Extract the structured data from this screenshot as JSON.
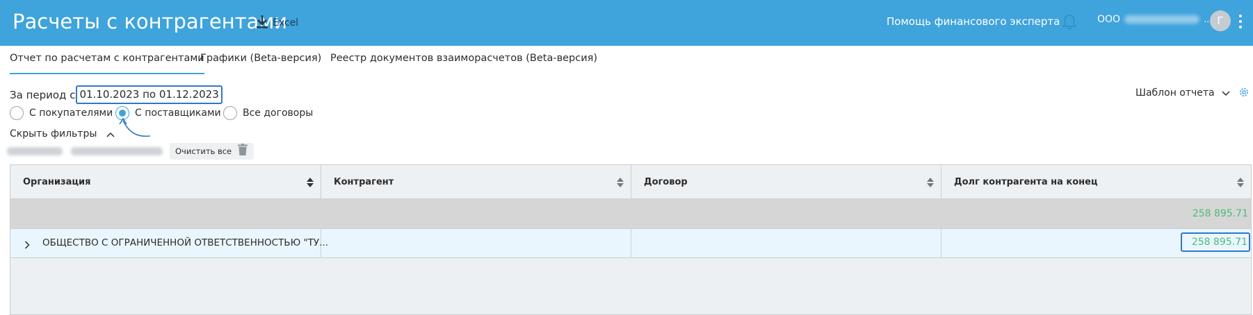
{
  "header": {
    "title": "Расчеты с контрагентами",
    "excel_label": "Excel",
    "help_link": "Помощь финансового эксперта",
    "org_prefix": "ООО",
    "org_suffix": "..",
    "avatar_initial": "Г",
    "icons": [
      "download-icon",
      "bell-icon",
      "kebab-menu-icon"
    ]
  },
  "tabs": [
    {
      "label": "Отчет по расчетам с контрагентами",
      "active": true
    },
    {
      "label": "Графики (Beta-версия)",
      "active": false
    },
    {
      "label": "Реестр документов взаиморасчетов (Beta-версия)",
      "active": false
    }
  ],
  "filters": {
    "period_label": "За период с",
    "period_range": "01.10.2023 по 01.12.2023",
    "template_label": "Шаблон отчета",
    "radios": [
      {
        "label": "С покупателями",
        "checked": false
      },
      {
        "label": "С поставщиками",
        "checked": true
      },
      {
        "label": "Все договоры",
        "checked": false
      }
    ],
    "hide_filters_label": "Скрыть фильтры",
    "clear_all_label": "Очистить все"
  },
  "table": {
    "columns": [
      "Организация",
      "Контрагент",
      "Договор",
      "Долг контрагента на конец"
    ],
    "total": "258 895.71",
    "rows": [
      {
        "organization": "ОБЩЕСТВО С ОГРАНИЧЕННОЙ ОТВЕТСТВЕННОСТЬЮ \"ТУ...",
        "counterparty": "",
        "contract": "",
        "debt": "258 895.71"
      }
    ]
  },
  "colors": {
    "header_bg": "#3fa3dc",
    "accent": "#3fa3dc",
    "highlight_border": "#2f78c4",
    "value_green": "#4dbb77",
    "total_row_bg": "#d6d6d6",
    "selected_row_bg": "#eaf6fd"
  }
}
